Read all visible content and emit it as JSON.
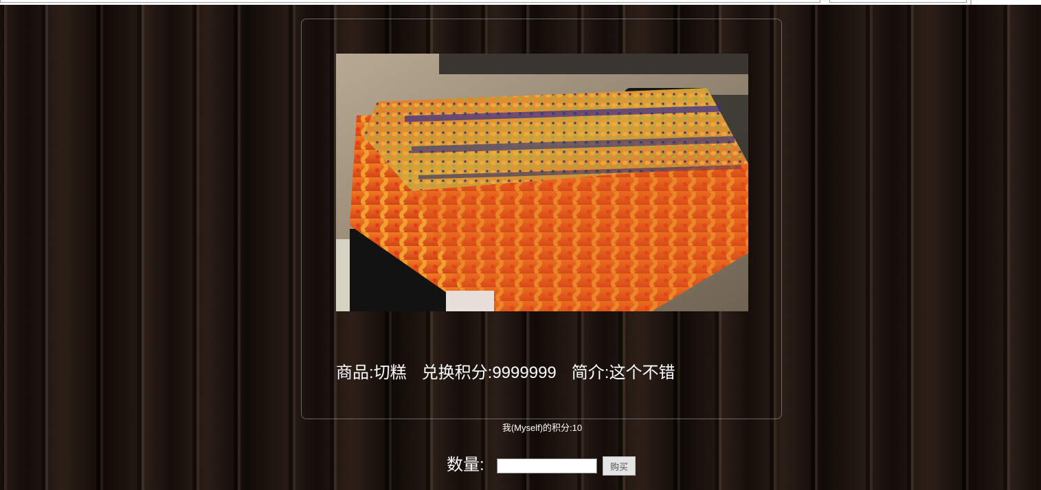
{
  "product": {
    "image_alt": "切糕",
    "name_text": "商品:切糕",
    "points_text": "兑换积分:9999999",
    "intro_text": "简介:这个不错"
  },
  "user": {
    "points_text": "我(Myself)的积分:10"
  },
  "purchase": {
    "quantity_label": "数量:",
    "quantity_value": "",
    "buy_label": "购买"
  }
}
